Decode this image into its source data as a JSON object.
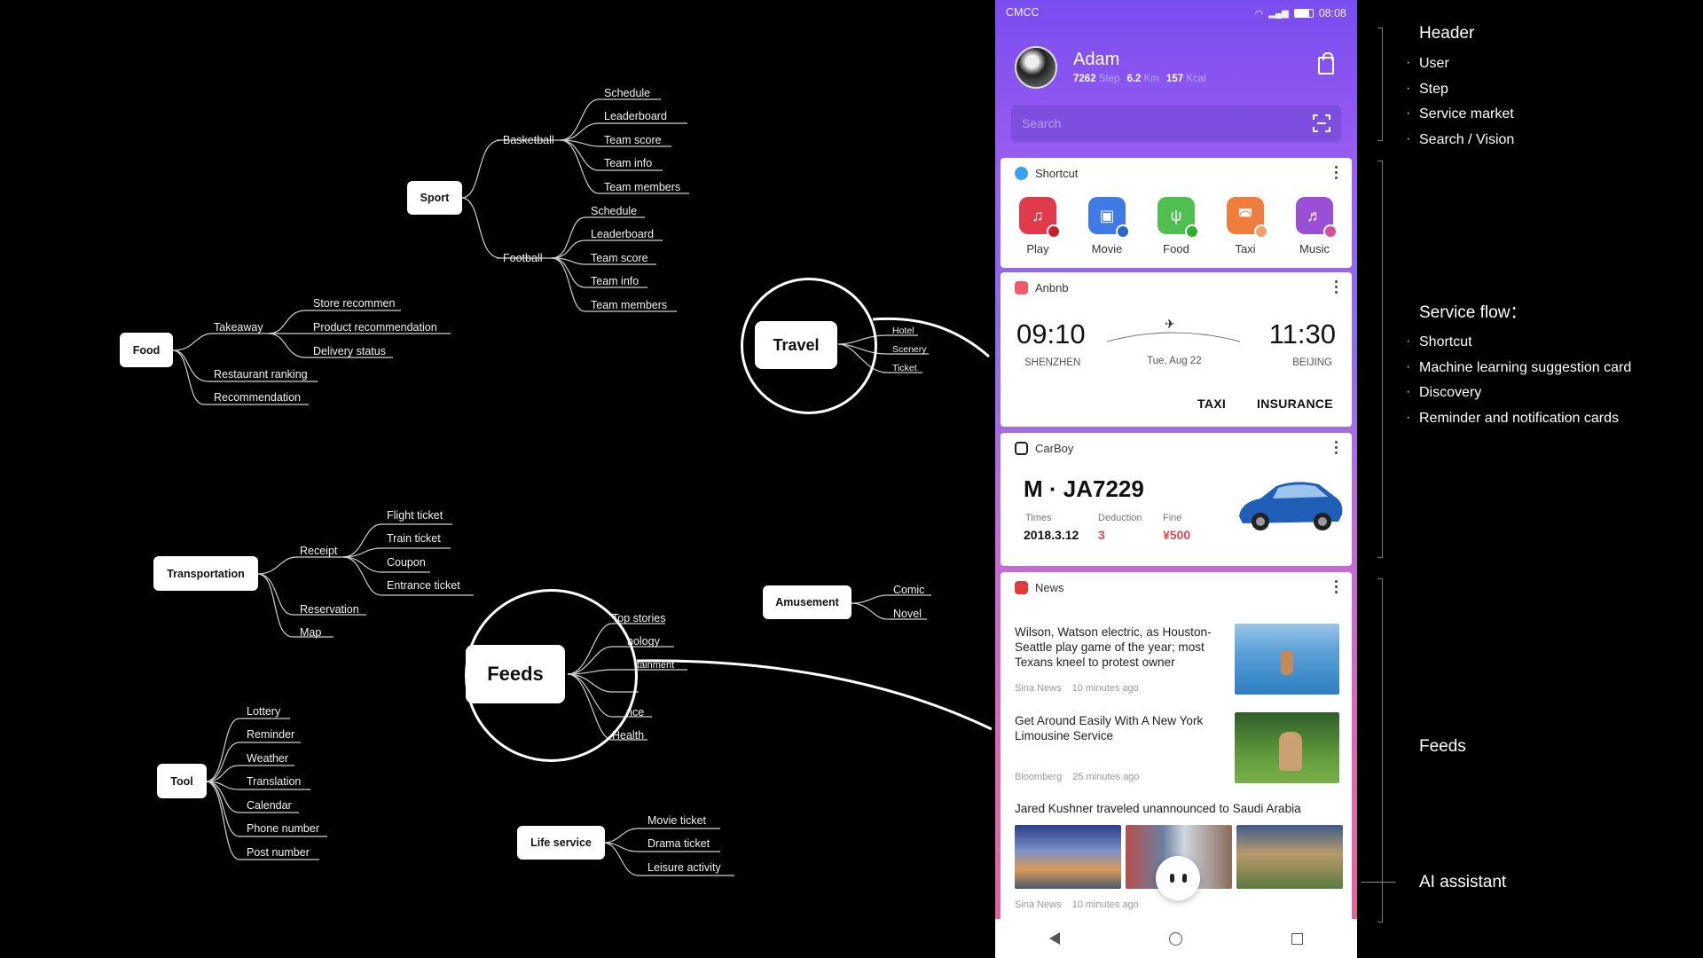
{
  "mindmap": {
    "sport": {
      "label": "Sport",
      "basketball": {
        "label": "Basketball",
        "items": [
          "Schedule",
          "Leaderboard",
          "Team score",
          "Team info",
          "Team members"
        ]
      },
      "football": {
        "label": "Football",
        "items": [
          "Schedule",
          "Leaderboard",
          "Team score",
          "Team info",
          "Team members"
        ]
      }
    },
    "food": {
      "label": "Food",
      "takeaway": {
        "label": "Takeaway",
        "items": [
          "Store recommen",
          "Product recommendation",
          "Delivery status"
        ]
      },
      "items": [
        "Restaurant ranking",
        "Recommendation"
      ]
    },
    "travel": {
      "label": "Travel",
      "items": [
        "Hotel",
        "Scenery",
        "Ticket"
      ]
    },
    "transportation": {
      "label": "Transportation",
      "receipt": {
        "label": "Receipt",
        "items": [
          "Flight ticket",
          "Train ticket",
          "Coupon",
          "Entrance ticket"
        ]
      },
      "items": [
        "Reservation",
        "Map"
      ]
    },
    "feeds": {
      "label": "Feeds",
      "items": [
        "Top stories",
        "nology",
        "tainment",
        "",
        "nce",
        "Health"
      ]
    },
    "amusement": {
      "label": "Amusement",
      "items": [
        "Comic",
        "Novel"
      ]
    },
    "tool": {
      "label": "Tool",
      "items": [
        "Lottery",
        "Reminder",
        "Weather",
        "Translation",
        "Calendar",
        "Phone number",
        "Post number"
      ]
    },
    "life_service": {
      "label": "Life service",
      "items": [
        "Movie ticket",
        "Drama ticket",
        "Leisure activity"
      ]
    }
  },
  "phone": {
    "status": {
      "carrier": "CMCC",
      "time": "08:08"
    },
    "user": {
      "name": "Adam",
      "steps": "7262",
      "steps_unit": "Step",
      "km": "6.2",
      "km_unit": "Km",
      "kcal": "157",
      "kcal_unit": "Kcal"
    },
    "search": {
      "placeholder": "Search"
    },
    "shortcut_card": {
      "title": "Shortcut",
      "items": [
        {
          "label": "Play",
          "color": "#e03a4b"
        },
        {
          "label": "Movie",
          "color": "#3f7ae6"
        },
        {
          "label": "Food",
          "color": "#4fbf4f"
        },
        {
          "label": "Taxi",
          "color": "#ef7e3e"
        },
        {
          "label": "Music",
          "color": "#9a4fd6"
        }
      ]
    },
    "flight_card": {
      "title": "Anbnb",
      "depart_time": "09:10",
      "depart_city": "SHENZHEN",
      "arrive_time": "11:30",
      "arrive_city": "BEIJING",
      "date": "Tue, Aug 22",
      "actions": [
        "TAXI",
        "INSURANCE"
      ]
    },
    "car_card": {
      "title": "CarBoy",
      "plate": "M · JA7229",
      "times_label": "Times",
      "times_value": "2018.3.12",
      "deduction_label": "Deduction",
      "deduction_value": "3",
      "fine_label": "Fine",
      "fine_value": "¥500"
    },
    "news_card": {
      "title": "News",
      "articles": [
        {
          "headline": "Wilson, Watson electric, as Houston-Seattle play game of the year; most Texans kneel to protest owner",
          "source": "Sina News",
          "time": "10 minutes ago"
        },
        {
          "headline": "Get Around Easily With A New York Limousine Service",
          "source": "Bloomberg",
          "time": "25 minutes ago"
        },
        {
          "headline": "Jared Kushner traveled unannounced to Saudi Arabia",
          "source": "Sina News",
          "time": "10 minutes ago"
        }
      ]
    }
  },
  "annotations": {
    "header": {
      "title": "Header",
      "items": [
        "User",
        "Step",
        "Service market",
        "Search / Vision"
      ]
    },
    "service_flow": {
      "title": "Service flow：",
      "items": [
        "Shortcut",
        "Machine learning suggestion card",
        "Discovery",
        "Reminder and notification cards"
      ]
    },
    "feeds": {
      "title": "Feeds"
    },
    "ai_assistant": {
      "title": "AI assistant"
    }
  },
  "colors": {
    "phone_gradient_top": "#7a4df0",
    "phone_gradient_bottom": "#e2649a",
    "fine_red": "#e04848"
  }
}
